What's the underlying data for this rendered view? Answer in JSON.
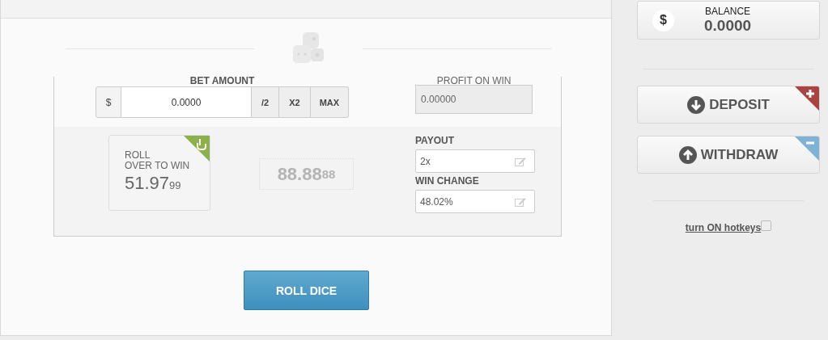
{
  "bet": {
    "label": "BET AMOUNT",
    "currency": "$",
    "value": "0.0000",
    "buttons": [
      "/2",
      "X2",
      "MAX"
    ]
  },
  "profit": {
    "label": "PROFIT ON WIN",
    "value": "0.00000"
  },
  "roll": {
    "line1": "ROLL",
    "line2": "OVER TO WIN",
    "value_main": "51.97",
    "value_small": "99"
  },
  "result": {
    "main": "88.88",
    "small": "88"
  },
  "fields": [
    {
      "label": "PAYOUT",
      "value": "2x"
    },
    {
      "label": "WIN CHANGE",
      "value": "48.02%"
    }
  ],
  "roll_button": "ROLL DICE",
  "balance": {
    "icon": "$",
    "label": "BALANCE",
    "value": "0.0000"
  },
  "actions": [
    {
      "kind": "deposit",
      "label": "DEPOSIT"
    },
    {
      "kind": "withdraw",
      "label": "WITHDRAW"
    }
  ],
  "hotkeys": {
    "label": "turn ON hotkeys",
    "checked": false
  }
}
